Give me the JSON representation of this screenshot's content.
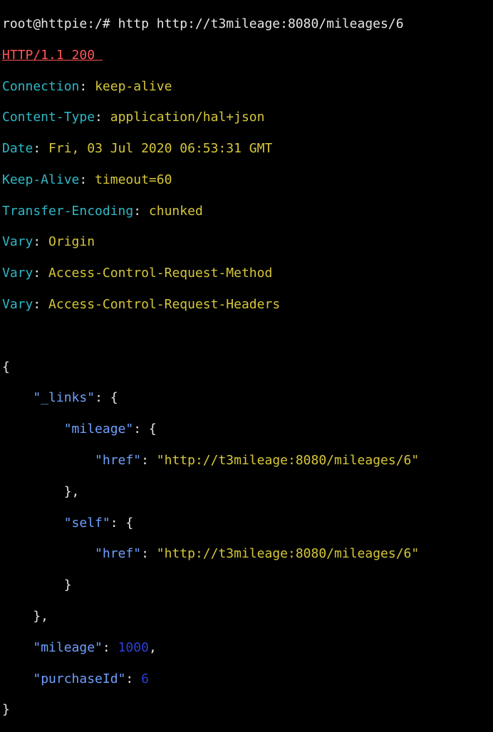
{
  "terminal": {
    "prompt": "root@httpie:/# ",
    "command": "http http://t3mileage:8080/mileages/6",
    "status_line": "HTTP/1.1 200 ",
    "headers": [
      {
        "name": "Connection",
        "value": "keep-alive"
      },
      {
        "name": "Content-Type",
        "value": "application/hal+json"
      },
      {
        "name": "Date",
        "value": "Fri, 03 Jul 2020 06:53:31 GMT"
      },
      {
        "name": "Keep-Alive",
        "value": "timeout=60"
      },
      {
        "name": "Transfer-Encoding",
        "value": "chunked"
      },
      {
        "name": "Vary",
        "value": "Origin"
      },
      {
        "name": "Vary",
        "value": "Access-Control-Request-Method"
      },
      {
        "name": "Vary",
        "value": "Access-Control-Request-Headers"
      }
    ],
    "body": {
      "links_key": "\"_links\"",
      "mileage_link_key": "\"mileage\"",
      "self_link_key": "\"self\"",
      "href_key": "\"href\"",
      "mileage_href": "\"http://t3mileage:8080/mileages/6\"",
      "self_href": "\"http://t3mileage:8080/mileages/6\"",
      "mileage_key": "\"mileage\"",
      "mileage_value": "1000",
      "purchase_key": "\"purchaseId\"",
      "purchase_value": "6"
    },
    "colors": {
      "background": "#000000",
      "status": "#ff5555",
      "header_name": "#2fb8c6",
      "header_value": "#d6c73a",
      "json_key": "#6fa0ff",
      "json_string": "#d6c73a",
      "json_number": "#2a3fd8"
    }
  }
}
